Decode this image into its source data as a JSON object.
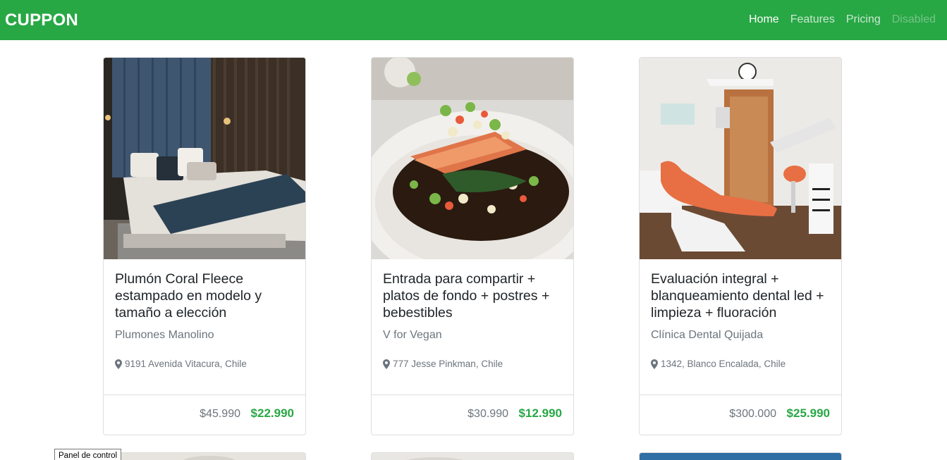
{
  "navbar": {
    "brand": "CUPPON",
    "links": [
      {
        "label": "Home",
        "state": "active"
      },
      {
        "label": "Features",
        "state": "normal"
      },
      {
        "label": "Pricing",
        "state": "normal"
      },
      {
        "label": "Disabled",
        "state": "disabled"
      }
    ]
  },
  "colors": {
    "brand_green": "#28a745",
    "muted": "#6c757d"
  },
  "deals": [
    {
      "image_icon": "bedroom-photo",
      "title": "Plumón Coral Fleece estampado en modelo y tamaño a elección",
      "merchant": "Plumones Manolino",
      "location": "9191 Avenida Vitacura, Chile",
      "price_old": "$45.990",
      "price_new": "$22.990"
    },
    {
      "image_icon": "salmon-dish-photo",
      "title": "Entrada para compartir + platos de fondo + postres + bebestibles",
      "merchant": "V for Vegan",
      "location": "777 Jesse Pinkman, Chile",
      "price_old": "$30.990",
      "price_new": "$12.990"
    },
    {
      "image_icon": "dental-clinic-photo",
      "title": "Evaluación integral + blanqueamiento dental led + limpieza + fluoración",
      "merchant": "Clínica Dental Quijada",
      "location": "1342, Blanco Encalada, Chile",
      "price_old": "$300.000",
      "price_new": "$25.990"
    }
  ],
  "tooltip": {
    "text": "Panel de control"
  }
}
